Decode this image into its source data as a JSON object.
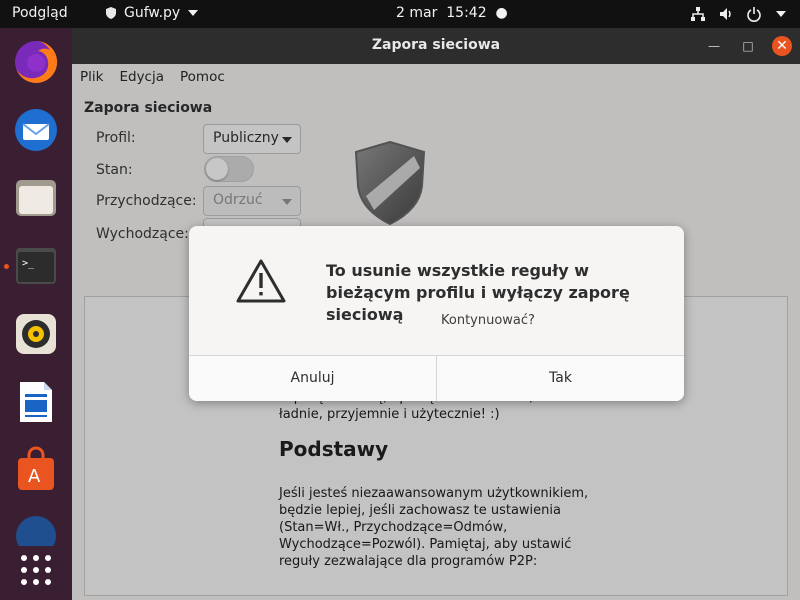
{
  "topbar": {
    "activities": "Podgląd",
    "app_name": "Gufw.py",
    "date": "2 mar",
    "time": "15:42"
  },
  "dock": {
    "items": [
      "firefox-icon",
      "thunderbird-icon",
      "files-icon",
      "terminal-icon",
      "rhythmbox-icon",
      "writer-icon",
      "software-icon",
      "help-icon"
    ],
    "app_grid_icon": "show-apps-icon"
  },
  "window": {
    "title": "Zapora sieciowa",
    "menu": [
      "Plik",
      "Edycja",
      "Pomoc"
    ],
    "section_title": "Zapora sieciowa",
    "labels": {
      "profile": "Profil:",
      "state": "Stan:",
      "incoming": "Przychodzące:",
      "outgoing": "Wychodzące:"
    },
    "profile_value": "Publiczny",
    "incoming_value": "Odrzuć",
    "state_on": false
  },
  "help": {
    "intro": "zaporą sieciową, opartą na ufw. Prosto, ładnie, przyjemnie i użytecznie! :)",
    "heading": "Podstawy",
    "body": "Jeśli jesteś niezaawansowanym użytkownikiem, będzie lepiej, jeśli zachowasz te ustawienia (Stan=Wł., Przychodzące=Odmów, Wychodzące=Pozwól). Pamiętaj, aby ustawić reguły zezwalające dla programów P2P:"
  },
  "dialog": {
    "title": "To usunie wszystkie reguły w bieżącym profilu i wyłączy zaporę sieciową",
    "subtitle": "Kontynuować?",
    "cancel": "Anuluj",
    "ok": "Tak"
  },
  "colors": {
    "accent": "#e95420",
    "dock": "#3a1f33",
    "topbar": "#111111"
  }
}
